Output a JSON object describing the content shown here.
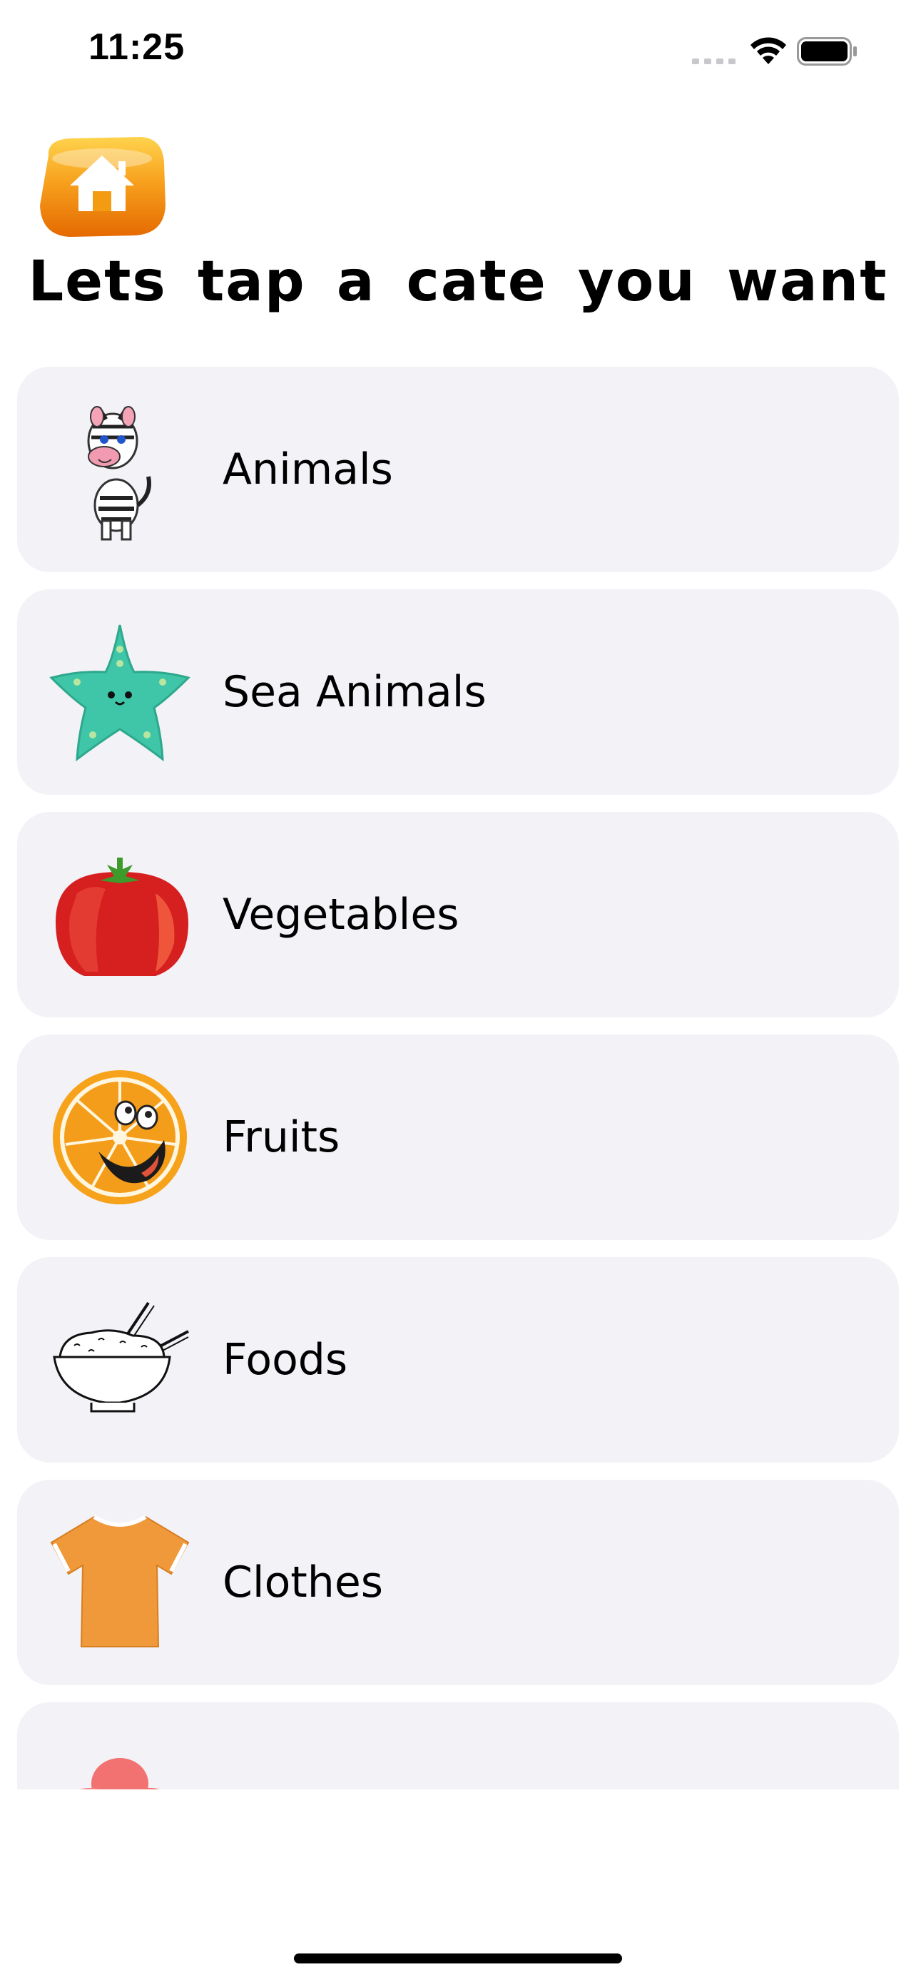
{
  "status_bar": {
    "time": "11:25"
  },
  "header": {
    "home_icon": "house-icon",
    "title": "Lets tap a cate you want"
  },
  "categories": [
    {
      "label": "Animals",
      "icon": "zebra-icon"
    },
    {
      "label": "Sea Animals",
      "icon": "starfish-icon"
    },
    {
      "label": "Vegetables",
      "icon": "tomato-icon"
    },
    {
      "label": "Fruits",
      "icon": "orange-icon"
    },
    {
      "label": "Foods",
      "icon": "rice-bowl-icon"
    },
    {
      "label": "Clothes",
      "icon": "tshirt-icon"
    },
    {
      "label": "",
      "icon": "flower-icon"
    }
  ],
  "colors": {
    "card_background": "#f2f2f7",
    "home_button": "#f39c12"
  }
}
